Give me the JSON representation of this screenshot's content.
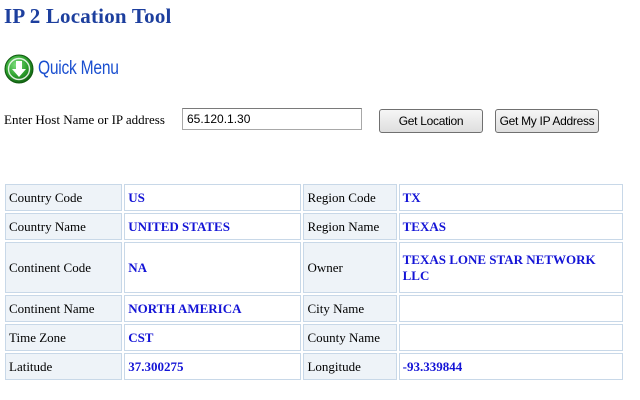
{
  "header": {
    "title": "IP 2 Location Tool"
  },
  "quick_menu": {
    "label": "Quick Menu",
    "icon": "down-arrow-circle-icon",
    "icon_color": "#2ea12e"
  },
  "lookup": {
    "label": "Enter Host Name or IP address",
    "input_value": "65.120.1.30",
    "get_location_label": "Get Location",
    "get_my_ip_label": "Get My IP Address"
  },
  "colors": {
    "title": "#1d3f9e",
    "link": "#1a4fd0",
    "value_text": "#1414d6",
    "label_bg": "#eef3f8",
    "cell_border": "#c8d8e8"
  },
  "results": {
    "rows": [
      {
        "left_label": "Country Code",
        "left_value": "US",
        "right_label": "Region Code",
        "right_value": "TX"
      },
      {
        "left_label": "Country Name",
        "left_value": "UNITED STATES",
        "right_label": "Region Name",
        "right_value": "TEXAS"
      },
      {
        "left_label": "Continent Code",
        "left_value": "NA",
        "right_label": "Owner",
        "right_value": "TEXAS LONE STAR NETWORK LLC"
      },
      {
        "left_label": "Continent Name",
        "left_value": "NORTH AMERICA",
        "right_label": "City Name",
        "right_value": ""
      },
      {
        "left_label": "Time Zone",
        "left_value": "CST",
        "right_label": "County Name",
        "right_value": ""
      },
      {
        "left_label": "Latitude",
        "left_value": "37.300275",
        "right_label": "Longitude",
        "right_value": "-93.339844"
      }
    ]
  }
}
